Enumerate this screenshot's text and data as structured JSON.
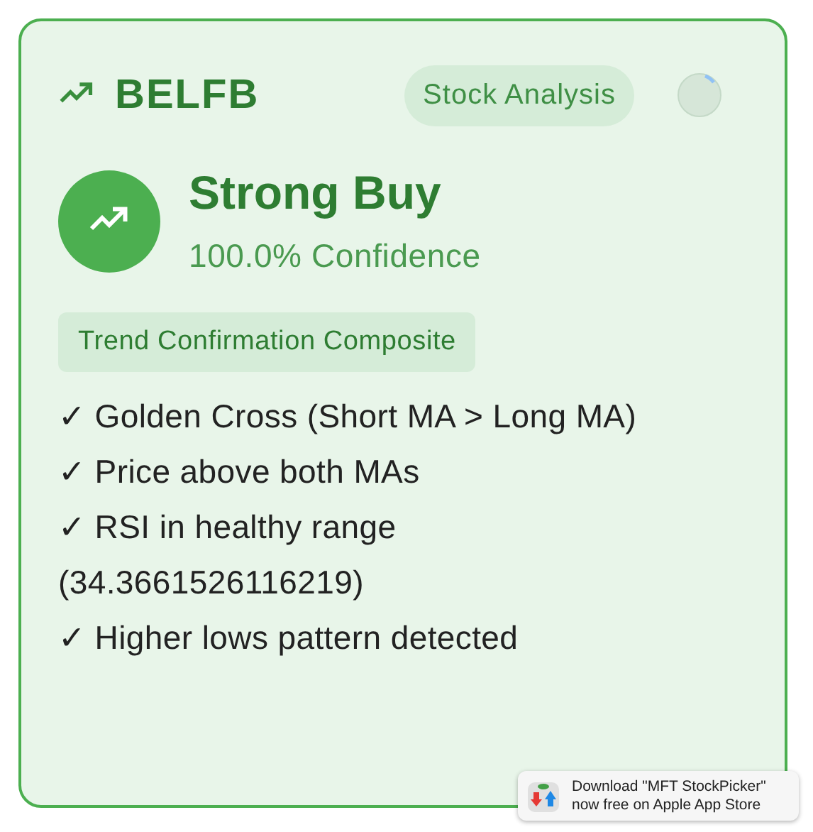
{
  "header": {
    "symbol": "BELFB",
    "badge": "Stock Analysis",
    "loading": true
  },
  "signal": {
    "kind": "buy",
    "title": "Strong Buy",
    "confidence": "100.0% Confidence"
  },
  "strategy": "Trend Confirmation Composite",
  "reasons": [
    "✓ Golden Cross (Short MA > Long MA)",
    "✓ Price above both MAs",
    "✓ RSI in healthy range (34.3661526116219)",
    "✓ Higher lows pattern detected"
  ],
  "promo": {
    "line_1": "Download \"MFT StockPicker\"",
    "line_2": "now free on Apple App Store"
  }
}
